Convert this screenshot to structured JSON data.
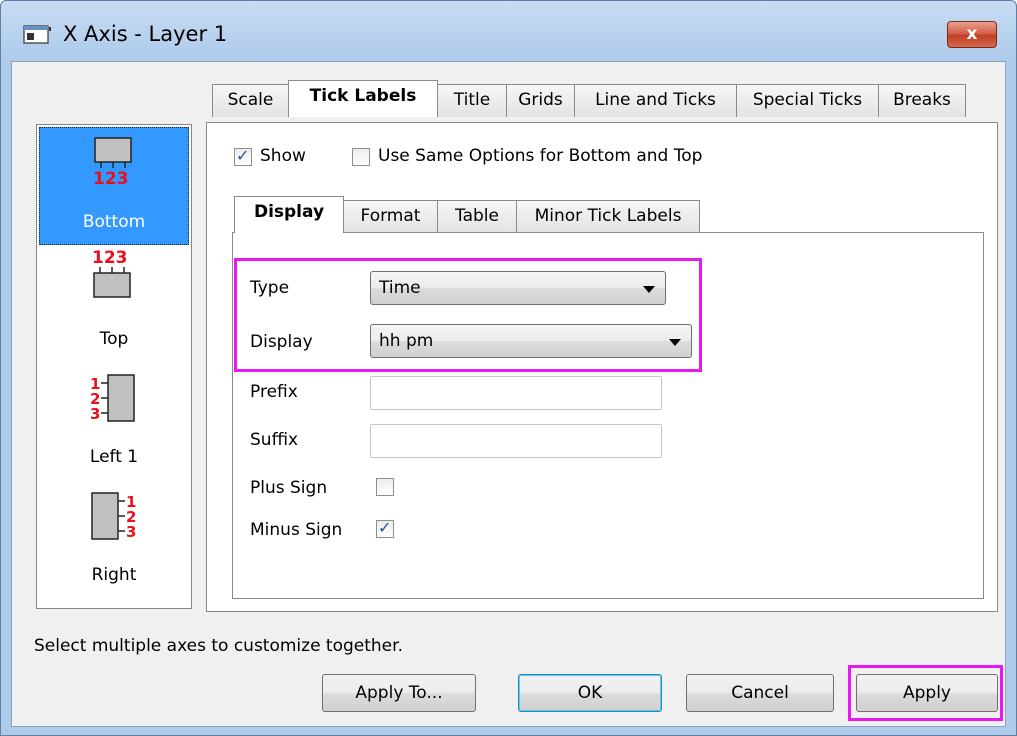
{
  "window": {
    "title": "X Axis - Layer 1",
    "close_glyph": "x",
    "icon": "app-window-icon"
  },
  "axes": [
    {
      "label": "Bottom",
      "glyph": "123",
      "selected": true
    },
    {
      "label": "Top",
      "glyph": "123",
      "selected": false
    },
    {
      "label": "Left 1",
      "glyph": "123",
      "selected": false
    },
    {
      "label": "Right",
      "glyph": "123",
      "selected": false
    }
  ],
  "tabs": [
    {
      "label": "Scale",
      "active": false
    },
    {
      "label": "Tick Labels",
      "active": true
    },
    {
      "label": "Title",
      "active": false
    },
    {
      "label": "Grids",
      "active": false
    },
    {
      "label": "Line and Ticks",
      "active": false
    },
    {
      "label": "Special Ticks",
      "active": false
    },
    {
      "label": "Breaks",
      "active": false
    }
  ],
  "options": {
    "show_label": "Show",
    "show_checked": true,
    "same_options_label": "Use Same Options for Bottom and Top",
    "same_options_checked": false
  },
  "subtabs": [
    {
      "label": "Display",
      "active": true
    },
    {
      "label": "Format",
      "active": false
    },
    {
      "label": "Table",
      "active": false
    },
    {
      "label": "Minor Tick Labels",
      "active": false
    }
  ],
  "form": {
    "type_label": "Type",
    "type_value": "Time",
    "display_label": "Display",
    "display_value": "hh pm",
    "prefix_label": "Prefix",
    "prefix_value": "",
    "suffix_label": "Suffix",
    "suffix_value": "",
    "plus_sign_label": "Plus Sign",
    "plus_sign_checked": false,
    "minus_sign_label": "Minus Sign",
    "minus_sign_checked": true
  },
  "status_text": "Select multiple axes to customize together.",
  "buttons": {
    "apply_to": "Apply To...",
    "ok": "OK",
    "cancel": "Cancel",
    "apply": "Apply"
  },
  "colors": {
    "highlight": "#e619f0",
    "selection": "#3399ff",
    "glyph_red": "#e8101a"
  }
}
